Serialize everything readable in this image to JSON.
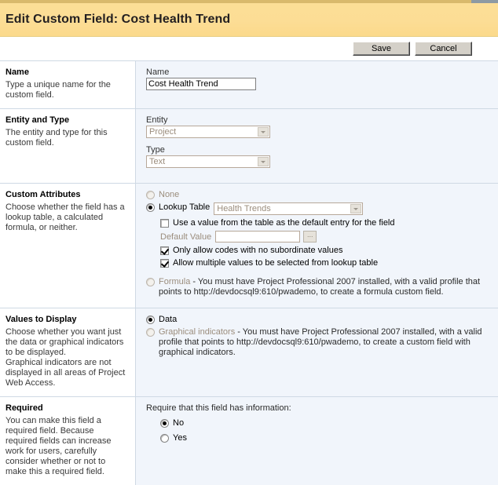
{
  "page": {
    "title": "Edit Custom Field: Cost Health Trend"
  },
  "toolbar": {
    "save_label": "Save",
    "cancel_label": "Cancel"
  },
  "sections": {
    "name": {
      "heading": "Name",
      "description": "Type a unique name for the custom field.",
      "field_label": "Name",
      "field_value": "Cost Health Trend"
    },
    "entity_type": {
      "heading": "Entity and Type",
      "description": "The entity and type for this custom field.",
      "entity_label": "Entity",
      "entity_value": "Project",
      "type_label": "Type",
      "type_value": "Text"
    },
    "custom_attributes": {
      "heading": "Custom Attributes",
      "description": "Choose whether the field has a lookup table, a calculated formula, or neither.",
      "none_label": "None",
      "lookup_table_label": "Lookup Table",
      "lookup_table_value": "Health Trends",
      "use_default_entry_label": "Use a value from the table as the default entry for the field",
      "default_value_label": "Default Value",
      "default_value": "",
      "default_value_picker_label": "...",
      "only_codes_label": "Only allow codes with no subordinate values",
      "allow_multiple_label": "Allow multiple values to be selected from lookup table",
      "formula_label": "Formula",
      "formula_note": " - You must have Project Professional 2007 installed, with a valid profile that points to http://devdocsql9:610/pwademo, to create a formula custom field."
    },
    "values_to_display": {
      "heading": "Values to Display",
      "description": "Choose whether you want just the data or graphical indicators to be displayed.\nGraphical indicators are not displayed in all areas of Project Web Access.",
      "data_label": "Data",
      "graphical_label": "Graphical indicators",
      "graphical_note": " - You must have Project Professional 2007 installed, with a valid profile that points to http://devdocsql9:610/pwademo, to create a custom field with graphical indicators."
    },
    "required": {
      "heading": "Required",
      "description": "You can make this field a required field. Because required fields can increase work for users, carefully consider whether or not to make this a required field.",
      "prompt": "Require that this field has information:",
      "no_label": "No",
      "yes_label": "Yes"
    }
  },
  "colors": {
    "banner": "#fcdd95",
    "panel": "#f1f5fb",
    "divider": "#cfd9e4",
    "muted_text": "#9b8d7d"
  }
}
